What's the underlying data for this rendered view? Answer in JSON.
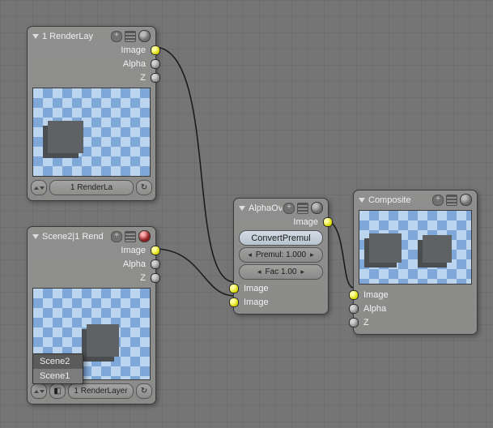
{
  "nodes": {
    "render1": {
      "title": "1 RenderLay",
      "outs": [
        "Image",
        "Alpha",
        "Z"
      ],
      "strip_label": "1 RenderLa"
    },
    "render2": {
      "title": "Scene2|1 Rend",
      "outs": [
        "Image",
        "Alpha",
        "Z"
      ],
      "strip_label": "1 RenderLayer",
      "menu": [
        "Scene2",
        "Scene1"
      ]
    },
    "alphaover": {
      "title": "AlphaOver",
      "out": "Image",
      "btn": "ConvertPremul",
      "premul": "Premul: 1.000",
      "fac": "Fac 1.00",
      "ins": [
        "Image",
        "Image"
      ]
    },
    "composite": {
      "title": "Composite",
      "ins": [
        "Image",
        "Alpha",
        "Z"
      ]
    }
  }
}
